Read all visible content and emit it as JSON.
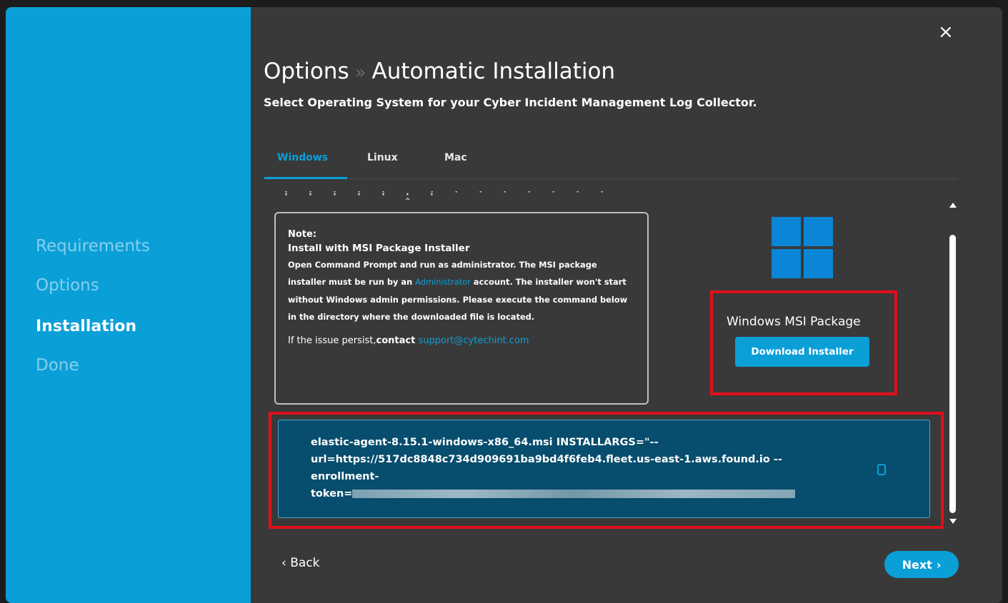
{
  "sidebar": {
    "steps": [
      {
        "label": "Requirements"
      },
      {
        "label": "Options"
      },
      {
        "label": "Installation"
      },
      {
        "label": "Done"
      }
    ]
  },
  "header": {
    "close_icon": "×",
    "title_part1": "Options",
    "title_separator": "»",
    "title_part2": "Automatic Installation",
    "subtitle": "Select Operating System for your Cyber Incident Management Log Collector."
  },
  "tabs": [
    {
      "label": "Windows",
      "active": true
    },
    {
      "label": "Linux",
      "active": false
    },
    {
      "label": "Mac",
      "active": false
    }
  ],
  "note": {
    "heading": "Note:",
    "subheading": "Install with MSI Package Installer",
    "body_1": "Open Command Prompt and run as administrator. The MSI package installer must be run by an",
    "admin_link": "Administrator",
    "body_2": "account. The installer won't start without Windows admin permissions. Please execute the command below in the directory where the downloaded file is located.",
    "issue_prefix": "If the issue persist,",
    "issue_contact": "contact",
    "support_email": "support@cytechint.com"
  },
  "package": {
    "icon": "windows-logo",
    "title": "Windows MSI Package",
    "download_label": "Download Installer"
  },
  "command": {
    "line1": "elastic-agent-8.15.1-windows-x86_64.msi INSTALLARGS=\"--",
    "line2": "url=https://517dc8848c734d909691ba9bd4f6feb4.fleet.us-east-1.aws.found.io --",
    "line3": "enrollment-",
    "line4_prefix": "token="
  },
  "footer": {
    "back_label": "Back",
    "next_label": "Next"
  },
  "colors": {
    "accent": "#0b9fd8",
    "highlight": "#e0101a",
    "panel": "#393939"
  }
}
